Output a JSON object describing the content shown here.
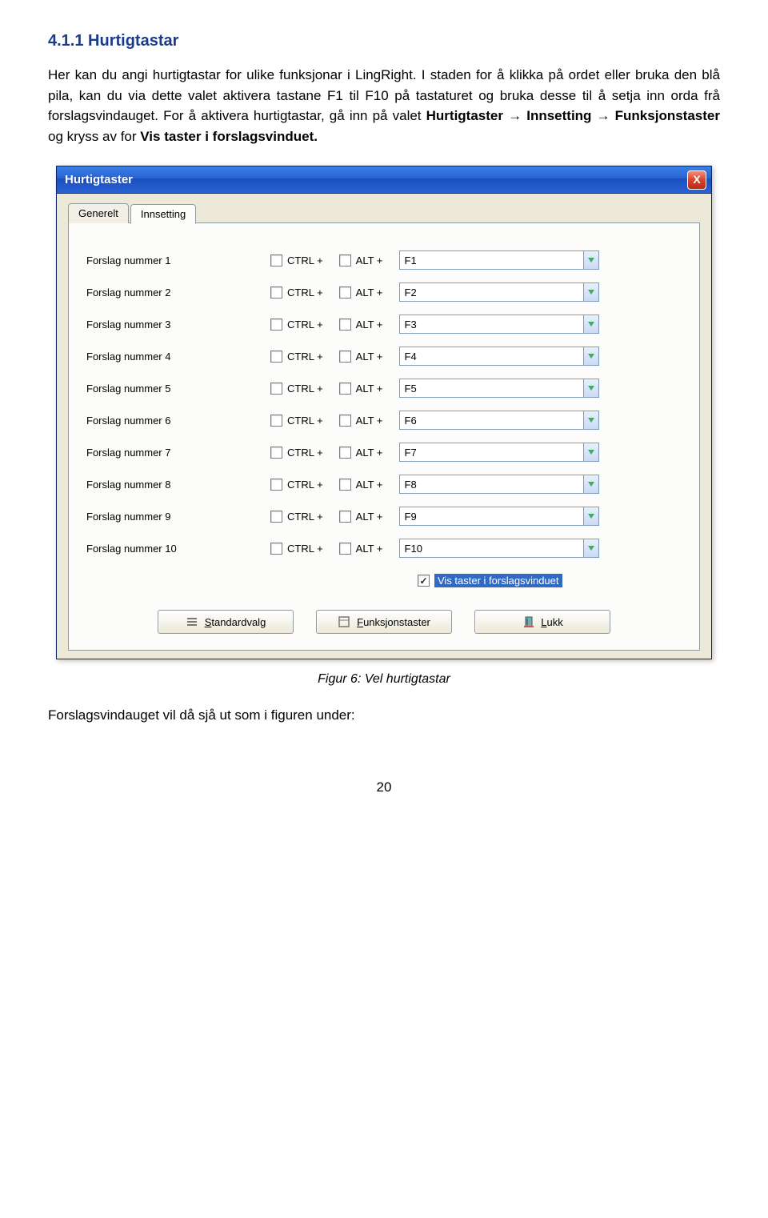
{
  "heading": "4.1.1 Hurtigtastar",
  "para1_prefix": "Her kan du angi hurtigtastar for ulike funksjonar i LingRight. I staden for å klikka på ordet eller bruka den blå pila, kan du via dette valet aktivera tastane F1 til F10 på tastaturet og bruka desse til å setja inn orda frå forslagsvindauget. For å aktivera hurtigtastar, gå inn på valet ",
  "menu_path": {
    "a": "Hurtigtaster",
    "b": "Innsetting",
    "c": "Funksjonstaster"
  },
  "para1_mid": " og kryss av for ",
  "para1_vis": "Vis taster i forslagsvinduet.",
  "dialog": {
    "title": "Hurtigtaster",
    "close": "X",
    "tabs": {
      "generelt": "Generelt",
      "innsetting": "Innsetting"
    },
    "ctrl": "CTRL +",
    "alt": "ALT +",
    "rows": [
      {
        "label": "Forslag nummer 1",
        "key": "F1"
      },
      {
        "label": "Forslag nummer 2",
        "key": "F2"
      },
      {
        "label": "Forslag nummer 3",
        "key": "F3"
      },
      {
        "label": "Forslag nummer 4",
        "key": "F4"
      },
      {
        "label": "Forslag nummer 5",
        "key": "F5"
      },
      {
        "label": "Forslag nummer 6",
        "key": "F6"
      },
      {
        "label": "Forslag nummer 7",
        "key": "F7"
      },
      {
        "label": "Forslag nummer 8",
        "key": "F8"
      },
      {
        "label": "Forslag nummer 9",
        "key": "F9"
      },
      {
        "label": "Forslag nummer 10",
        "key": "F10"
      }
    ],
    "vis_label": "Vis taster i forslagsvinduet",
    "buttons": {
      "standard": {
        "pre": "",
        "ul": "S",
        "rest": "tandardvalg"
      },
      "funksjon": {
        "pre": "",
        "ul": "F",
        "rest": "unksjonstaster"
      },
      "lukk": {
        "pre": "",
        "ul": "L",
        "rest": "ukk"
      }
    }
  },
  "caption": "Figur 6: Vel hurtigtastar",
  "after": "Forslagsvindauget vil då sjå ut som i figuren under:",
  "page": "20"
}
